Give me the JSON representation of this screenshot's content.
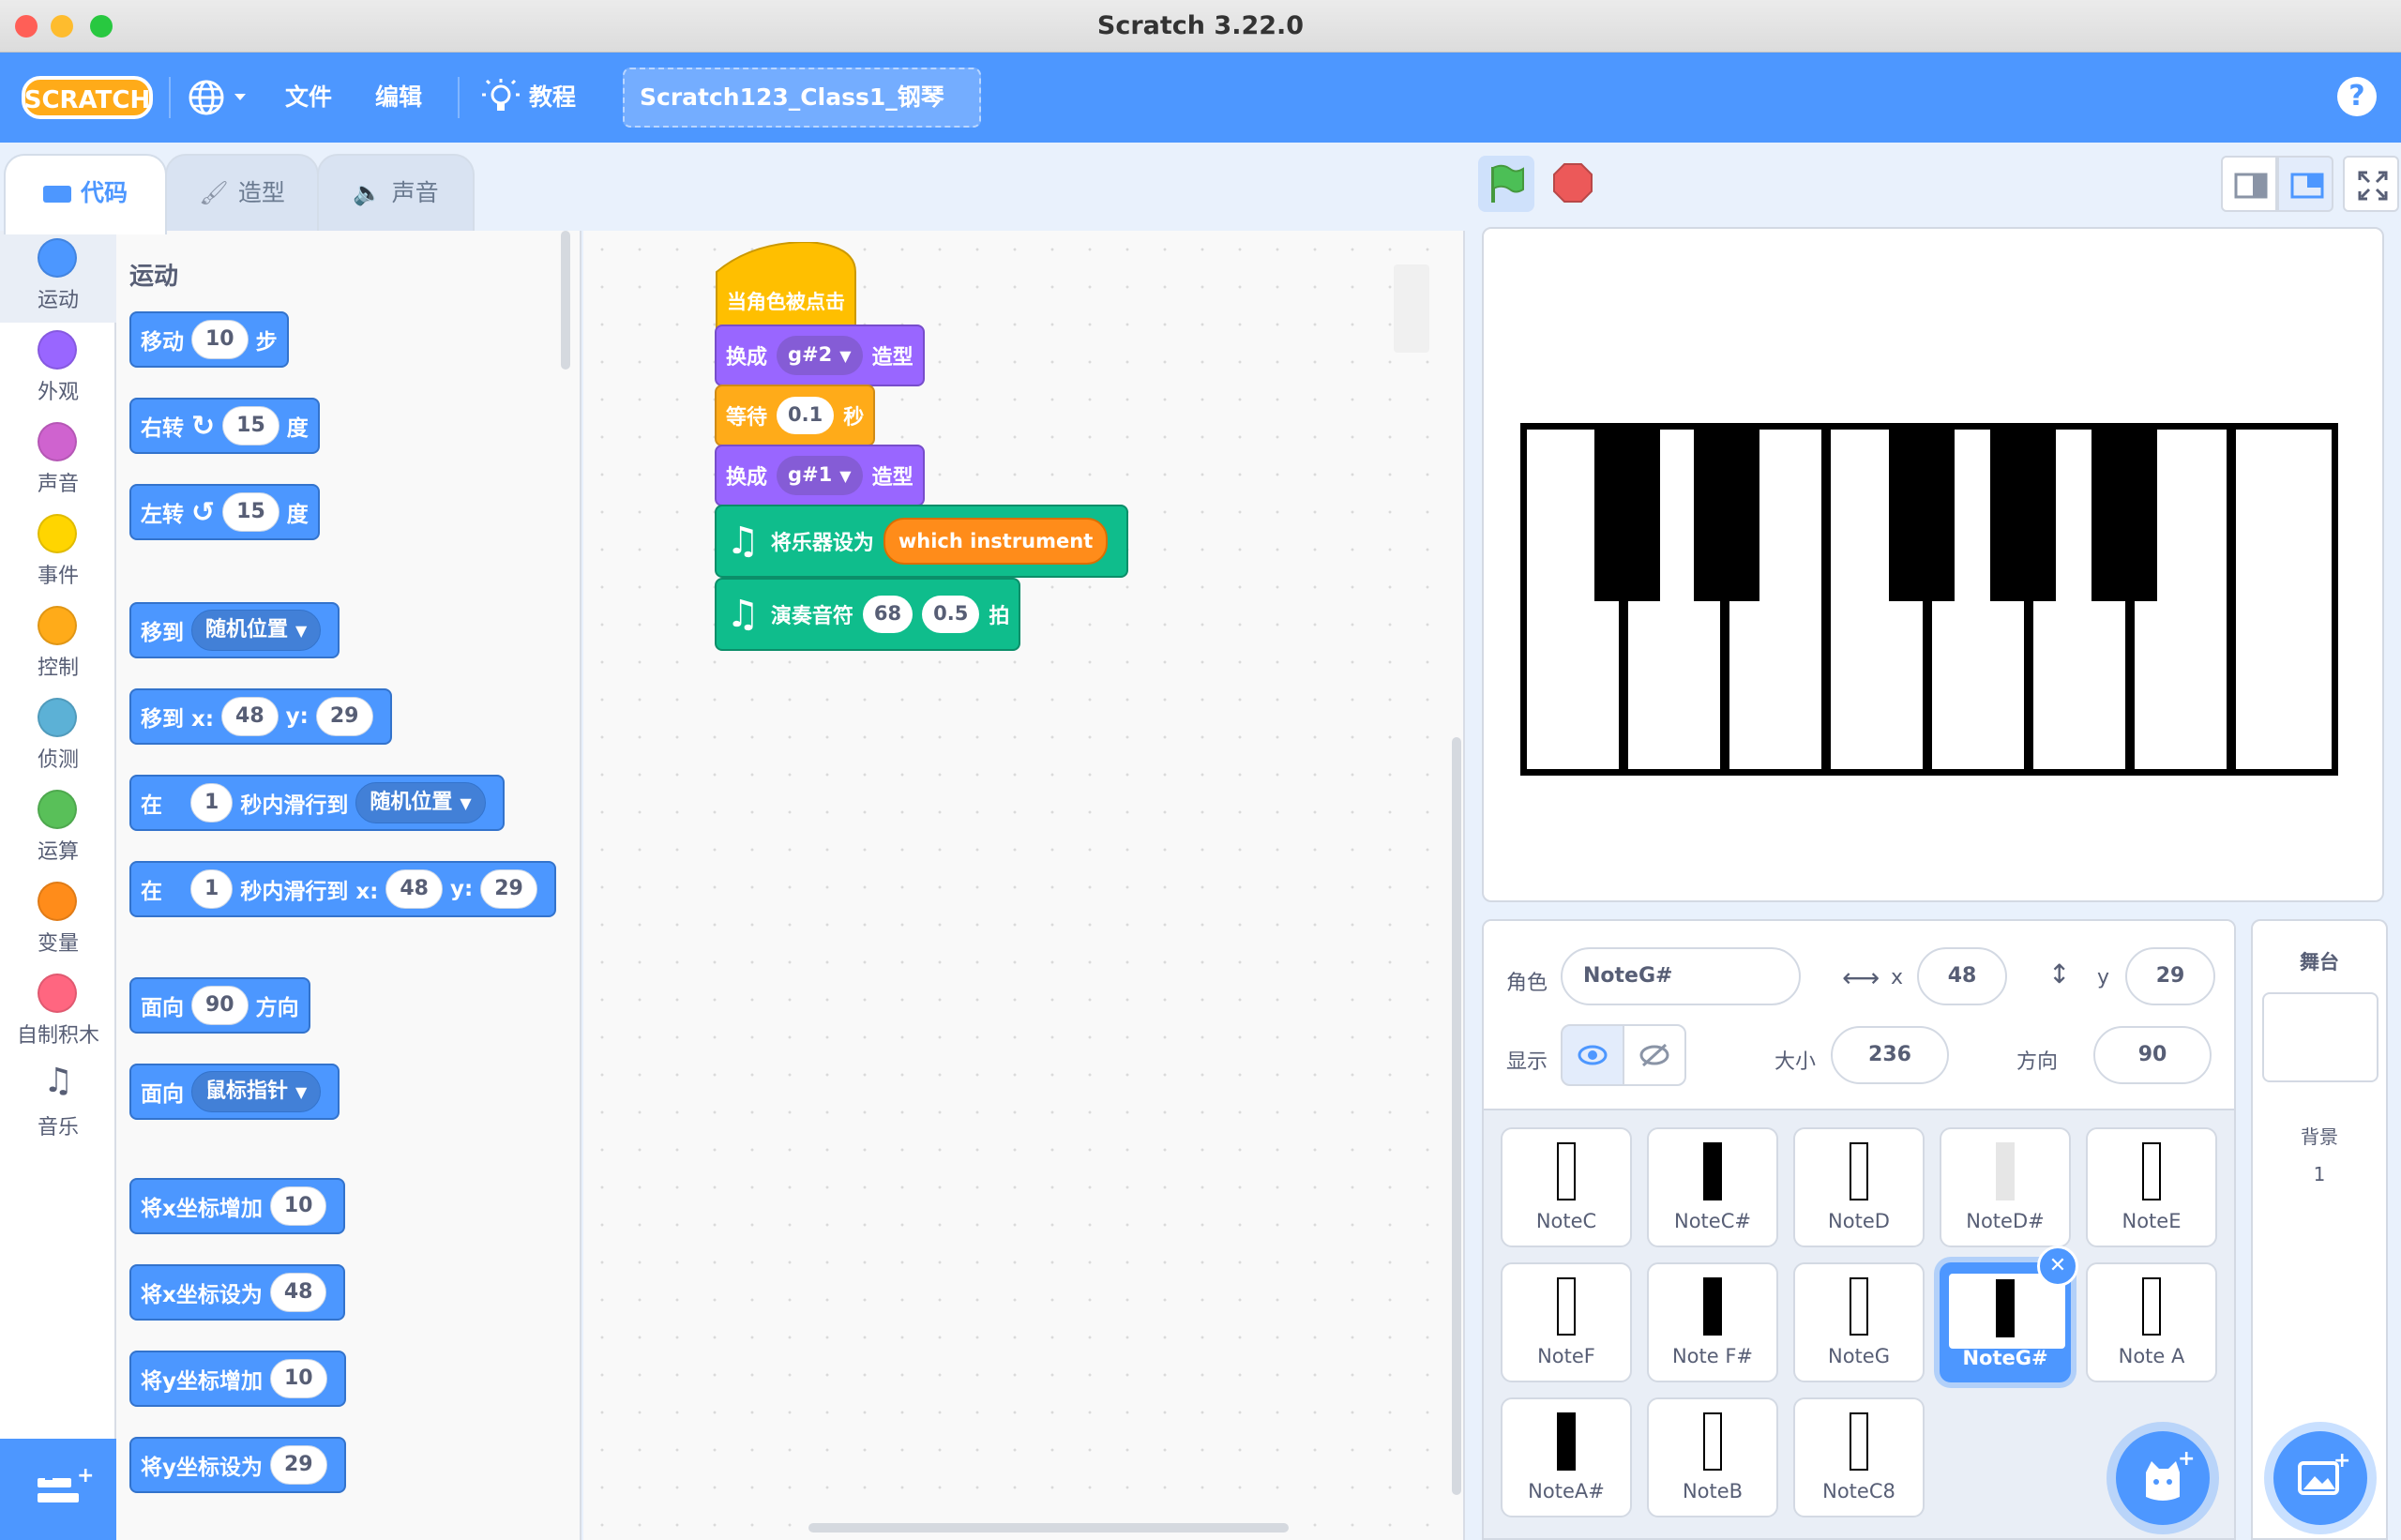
{
  "window": {
    "title": "Scratch 3.22.0"
  },
  "menu": {
    "file": "文件",
    "edit": "编辑",
    "tutorials": "教程",
    "project_title": "Scratch123_Class1_钢琴",
    "logo": "SCRATCH"
  },
  "tabs": {
    "code": "代码",
    "costumes": "造型",
    "sounds": "声音"
  },
  "categories": [
    {
      "label": "运动",
      "color": "#4c97ff"
    },
    {
      "label": "外观",
      "color": "#9966ff"
    },
    {
      "label": "声音",
      "color": "#cf63cf"
    },
    {
      "label": "事件",
      "color": "#ffd500"
    },
    {
      "label": "控制",
      "color": "#ffab19"
    },
    {
      "label": "侦测",
      "color": "#5cb1d6"
    },
    {
      "label": "运算",
      "color": "#59c059"
    },
    {
      "label": "变量",
      "color": "#ff8c1a"
    },
    {
      "label": "自制积木",
      "color": "#ff6680"
    },
    {
      "label": "音乐",
      "color": "#0fbd8c"
    }
  ],
  "palette": {
    "title": "运动",
    "move": {
      "a": "移动",
      "n": "10",
      "b": "步"
    },
    "turn_right": {
      "a": "右转",
      "n": "15",
      "b": "度"
    },
    "turn_left": {
      "a": "左转",
      "n": "15",
      "b": "度"
    },
    "goto": {
      "a": "移到",
      "dd": "随机位置"
    },
    "goto_xy": {
      "a": "移到 x:",
      "x": "48",
      "ylab": "y:",
      "y": "29"
    },
    "glide": {
      "a": "在",
      "n": "1",
      "b": "秒内滑行到",
      "dd": "随机位置"
    },
    "glide_xy": {
      "a": "在",
      "n": "1",
      "b": "秒内滑行到 x:",
      "x": "48",
      "ylab": "y:",
      "y": "29"
    },
    "point_dir": {
      "a": "面向",
      "n": "90",
      "b": "方向"
    },
    "point_towards": {
      "a": "面向",
      "dd": "鼠标指针"
    },
    "change_x": {
      "a": "将x坐标增加",
      "n": "10"
    },
    "set_x": {
      "a": "将x坐标设为",
      "n": "48"
    },
    "change_y": {
      "a": "将y坐标增加",
      "n": "10"
    },
    "set_y": {
      "a": "将y坐标设为",
      "n": "29"
    }
  },
  "script": {
    "hat": "当角色被点击",
    "switch1": {
      "a": "换成",
      "dd": "g#2",
      "b": "造型"
    },
    "wait": {
      "a": "等待",
      "n": "0.1",
      "b": "秒"
    },
    "switch2": {
      "a": "换成",
      "dd": "g#1",
      "b": "造型"
    },
    "set_instrument": {
      "a": "将乐器设为",
      "reporter": "which instrument"
    },
    "play_note": {
      "a": "演奏音符",
      "note": "68",
      "beats": "0.5",
      "b": "拍"
    }
  },
  "sprite_info": {
    "sprite_label": "角色",
    "sprite_name": "NoteG#",
    "x_label": "x",
    "x": "48",
    "y_label": "y",
    "y": "29",
    "show_label": "显示",
    "size_label": "大小",
    "size": "236",
    "direction_label": "方向",
    "direction": "90"
  },
  "sprites": [
    {
      "name": "NoteC",
      "key": "white"
    },
    {
      "name": "NoteC#",
      "key": "black"
    },
    {
      "name": "NoteD",
      "key": "white"
    },
    {
      "name": "NoteD#",
      "key": "faded"
    },
    {
      "name": "NoteE",
      "key": "white"
    },
    {
      "name": "NoteF",
      "key": "white"
    },
    {
      "name": "Note F#",
      "key": "black"
    },
    {
      "name": "NoteG",
      "key": "white"
    },
    {
      "name": "NoteG#",
      "key": "black",
      "selected": true
    },
    {
      "name": "Note A",
      "key": "white"
    },
    {
      "name": "NoteA#",
      "key": "black"
    },
    {
      "name": "NoteB",
      "key": "white"
    },
    {
      "name": "NoteC8",
      "key": "white"
    }
  ],
  "stage_pane": {
    "title": "舞台",
    "backdrop_label": "背景",
    "backdrop_count": "1"
  },
  "colors": {
    "motion": "#4c97ff",
    "looks": "#9966ff",
    "events": "#ffbf00",
    "control": "#ffab19",
    "music": "#0fbd8c",
    "reporter": "#ff8c1a",
    "menu": "#4d97ff"
  }
}
